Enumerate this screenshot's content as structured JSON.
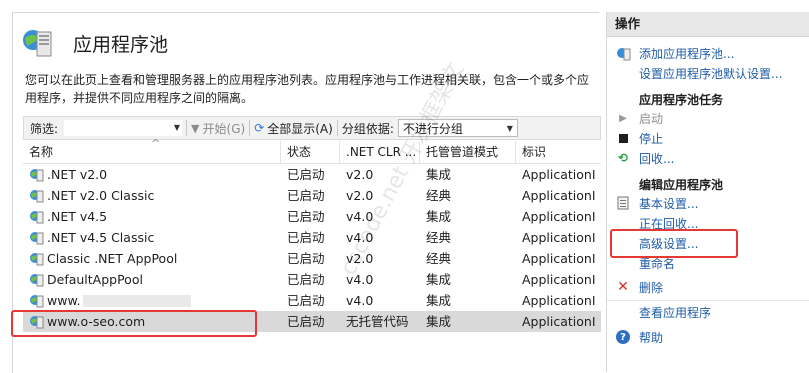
{
  "page": {
    "title": "应用程序池",
    "description": "您可以在此页上查看和管理服务器上的应用程序池列表。应用程序池与工作进程相关联，包含一个或多个应用程序，并提供不同应用程序之间的隔离。"
  },
  "toolbar": {
    "filter_label": "筛选:",
    "start_label": "开始(G)",
    "show_all_label": "全部显示(A)",
    "groupby_label": "分组依据:",
    "groupby_value": "不进行分组"
  },
  "table": {
    "columns": [
      "名称",
      "状态",
      ".NET CLR ...",
      "托管管道模式",
      "标识"
    ],
    "rows": [
      {
        "name": ".NET v2.0",
        "status": "已启动",
        "clr": "v2.0",
        "pipeline": "集成",
        "identity": "ApplicationI"
      },
      {
        "name": ".NET v2.0 Classic",
        "status": "已启动",
        "clr": "v2.0",
        "pipeline": "经典",
        "identity": "ApplicationI"
      },
      {
        "name": ".NET v4.5",
        "status": "已启动",
        "clr": "v4.0",
        "pipeline": "集成",
        "identity": "ApplicationI"
      },
      {
        "name": ".NET v4.5 Classic",
        "status": "已启动",
        "clr": "v4.0",
        "pipeline": "经典",
        "identity": "ApplicationI"
      },
      {
        "name": "Classic .NET AppPool",
        "status": "已启动",
        "clr": "v2.0",
        "pipeline": "经典",
        "identity": "ApplicationI"
      },
      {
        "name": "DefaultAppPool",
        "status": "已启动",
        "clr": "v4.0",
        "pipeline": "集成",
        "identity": "ApplicationI"
      },
      {
        "name": "www.",
        "status": "已启动",
        "clr": "v4.0",
        "pipeline": "集成",
        "identity": "ApplicationI"
      },
      {
        "name": "www.o-seo.com",
        "status": "已启动",
        "clr": "无托管代码",
        "pipeline": "集成",
        "identity": "ApplicationI"
      }
    ]
  },
  "actions": {
    "header": "操作",
    "add_pool": "添加应用程序池...",
    "set_defaults": "设置应用程序池默认设置...",
    "tasks_title": "应用程序池任务",
    "start": "启动",
    "stop": "停止",
    "recycle": "回收...",
    "edit_title": "编辑应用程序池",
    "basic_settings": "基本设置...",
    "recycling": "正在回收...",
    "advanced_settings": "高级设置...",
    "rename": "重命名",
    "delete": "删除",
    "view_apps": "查看应用程序",
    "help": "帮助"
  },
  "watermark": "cscode.net 开发框架文"
}
